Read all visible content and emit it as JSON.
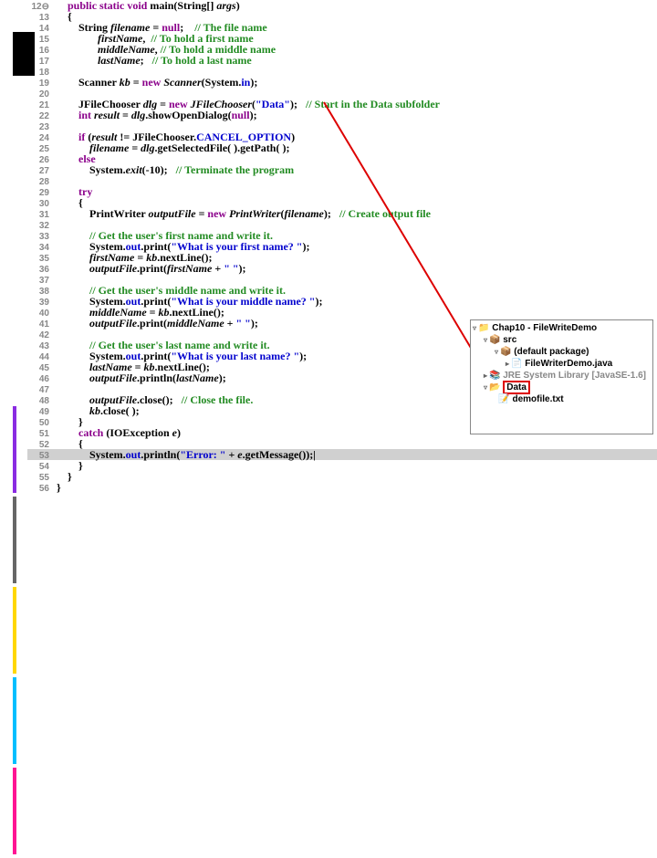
{
  "lines": [
    {
      "n": "12⊖",
      "tokens": [
        [
          "    ",
          "p"
        ],
        [
          "public static void",
          "kw"
        ],
        [
          " ",
          "p"
        ],
        [
          "main",
          "mth"
        ],
        [
          "(String[] ",
          "p"
        ],
        [
          "args",
          "id"
        ],
        [
          ")",
          "p"
        ]
      ]
    },
    {
      "n": "13",
      "tokens": [
        [
          "    {",
          "p"
        ]
      ]
    },
    {
      "n": "14",
      "tokens": [
        [
          "        String ",
          "p"
        ],
        [
          "filename",
          "id"
        ],
        [
          " = ",
          "p"
        ],
        [
          "null",
          "kw"
        ],
        [
          ";    ",
          "p"
        ],
        [
          "// The file name",
          "com"
        ]
      ]
    },
    {
      "n": "15",
      "tokens": [
        [
          "               ",
          "p"
        ],
        [
          "firstName",
          "id"
        ],
        [
          ",  ",
          "p"
        ],
        [
          "// To hold a first name",
          "com"
        ]
      ]
    },
    {
      "n": "16",
      "tokens": [
        [
          "               ",
          "p"
        ],
        [
          "middleName",
          "id"
        ],
        [
          ", ",
          "p"
        ],
        [
          "// To hold a middle name",
          "com"
        ]
      ]
    },
    {
      "n": "17",
      "tokens": [
        [
          "               ",
          "p"
        ],
        [
          "lastName",
          "id"
        ],
        [
          ";   ",
          "p"
        ],
        [
          "// To hold a last name",
          "com"
        ]
      ]
    },
    {
      "n": "18",
      "tokens": []
    },
    {
      "n": "19",
      "tokens": [
        [
          "        Scanner ",
          "p"
        ],
        [
          "kb",
          "id"
        ],
        [
          " = ",
          "p"
        ],
        [
          "new",
          "kw"
        ],
        [
          " ",
          "p"
        ],
        [
          "Scanner",
          "id"
        ],
        [
          "(System.",
          "p"
        ],
        [
          "in",
          "fld"
        ],
        [
          ");",
          "p"
        ]
      ]
    },
    {
      "n": "20",
      "tokens": []
    },
    {
      "n": "21",
      "tokens": [
        [
          "        JFileChooser ",
          "p"
        ],
        [
          "dlg",
          "id"
        ],
        [
          " = ",
          "p"
        ],
        [
          "new",
          "kw"
        ],
        [
          " ",
          "p"
        ],
        [
          "JFileChooser",
          "id"
        ],
        [
          "(",
          "p"
        ],
        [
          "\"Data\"",
          "str"
        ],
        [
          ");   ",
          "p"
        ],
        [
          "// Start in the Data subfolder",
          "com"
        ]
      ]
    },
    {
      "n": "22",
      "tokens": [
        [
          "        ",
          "p"
        ],
        [
          "int",
          "kw"
        ],
        [
          " ",
          "p"
        ],
        [
          "result",
          "id"
        ],
        [
          " = ",
          "p"
        ],
        [
          "dlg",
          "id"
        ],
        [
          ".showOpenDialog(",
          "p"
        ],
        [
          "null",
          "kw"
        ],
        [
          ");",
          "p"
        ]
      ]
    },
    {
      "n": "23",
      "tokens": []
    },
    {
      "n": "24",
      "tokens": [
        [
          "        ",
          "p"
        ],
        [
          "if",
          "kw"
        ],
        [
          " (",
          "p"
        ],
        [
          "result",
          "id"
        ],
        [
          " != JFileChooser.",
          "p"
        ],
        [
          "CANCEL_OPTION",
          "cn"
        ],
        [
          ")",
          "p"
        ]
      ]
    },
    {
      "n": "25",
      "tokens": [
        [
          "            ",
          "p"
        ],
        [
          "filename",
          "id"
        ],
        [
          " = ",
          "p"
        ],
        [
          "dlg",
          "id"
        ],
        [
          ".getSelectedFile( ).getPath( );",
          "p"
        ]
      ]
    },
    {
      "n": "26",
      "tokens": [
        [
          "        ",
          "p"
        ],
        [
          "else",
          "kw"
        ]
      ]
    },
    {
      "n": "27",
      "tokens": [
        [
          "            System.",
          "p"
        ],
        [
          "exit",
          "id"
        ],
        [
          "(-10);   ",
          "p"
        ],
        [
          "// Terminate the program",
          "com"
        ]
      ]
    },
    {
      "n": "28",
      "tokens": []
    },
    {
      "n": "29",
      "tokens": [
        [
          "        ",
          "p"
        ],
        [
          "try",
          "kw"
        ]
      ]
    },
    {
      "n": "30",
      "tokens": [
        [
          "        {",
          "p"
        ]
      ]
    },
    {
      "n": "31",
      "tokens": [
        [
          "            PrintWriter ",
          "p"
        ],
        [
          "outputFile",
          "id"
        ],
        [
          " = ",
          "p"
        ],
        [
          "new",
          "kw"
        ],
        [
          " ",
          "p"
        ],
        [
          "PrintWriter",
          "id"
        ],
        [
          "(",
          "p"
        ],
        [
          "filename",
          "id"
        ],
        [
          ");   ",
          "p"
        ],
        [
          "// Create output file",
          "com"
        ]
      ]
    },
    {
      "n": "32",
      "tokens": []
    },
    {
      "n": "33",
      "tokens": [
        [
          "            ",
          "p"
        ],
        [
          "// Get the user's first name and write it.",
          "com"
        ]
      ]
    },
    {
      "n": "34",
      "tokens": [
        [
          "            System.",
          "p"
        ],
        [
          "out",
          "fld"
        ],
        [
          ".print(",
          "p"
        ],
        [
          "\"What is your first name? \"",
          "str"
        ],
        [
          ");",
          "p"
        ]
      ]
    },
    {
      "n": "35",
      "tokens": [
        [
          "            ",
          "p"
        ],
        [
          "firstName",
          "id"
        ],
        [
          " = ",
          "p"
        ],
        [
          "kb",
          "id"
        ],
        [
          ".nextLine();",
          "p"
        ]
      ]
    },
    {
      "n": "36",
      "tokens": [
        [
          "            ",
          "p"
        ],
        [
          "outputFile",
          "id"
        ],
        [
          ".print(",
          "p"
        ],
        [
          "firstName",
          "id"
        ],
        [
          " + ",
          "p"
        ],
        [
          "\" \"",
          "str"
        ],
        [
          ");",
          "p"
        ]
      ]
    },
    {
      "n": "37",
      "tokens": []
    },
    {
      "n": "38",
      "tokens": [
        [
          "            ",
          "p"
        ],
        [
          "// Get the user's middle name and write it.",
          "com"
        ]
      ]
    },
    {
      "n": "39",
      "tokens": [
        [
          "            System.",
          "p"
        ],
        [
          "out",
          "fld"
        ],
        [
          ".print(",
          "p"
        ],
        [
          "\"What is your middle name? \"",
          "str"
        ],
        [
          ");",
          "p"
        ]
      ]
    },
    {
      "n": "40",
      "tokens": [
        [
          "            ",
          "p"
        ],
        [
          "middleName",
          "id"
        ],
        [
          " = ",
          "p"
        ],
        [
          "kb",
          "id"
        ],
        [
          ".nextLine();",
          "p"
        ]
      ]
    },
    {
      "n": "41",
      "tokens": [
        [
          "            ",
          "p"
        ],
        [
          "outputFile",
          "id"
        ],
        [
          ".print(",
          "p"
        ],
        [
          "middleName",
          "id"
        ],
        [
          " + ",
          "p"
        ],
        [
          "\" \"",
          "str"
        ],
        [
          ");",
          "p"
        ]
      ]
    },
    {
      "n": "42",
      "tokens": []
    },
    {
      "n": "43",
      "tokens": [
        [
          "            ",
          "p"
        ],
        [
          "// Get the user's last name and write it.",
          "com"
        ]
      ]
    },
    {
      "n": "44",
      "tokens": [
        [
          "            System.",
          "p"
        ],
        [
          "out",
          "fld"
        ],
        [
          ".print(",
          "p"
        ],
        [
          "\"What is your last name? \"",
          "str"
        ],
        [
          ");",
          "p"
        ]
      ]
    },
    {
      "n": "45",
      "tokens": [
        [
          "            ",
          "p"
        ],
        [
          "lastName",
          "id"
        ],
        [
          " = ",
          "p"
        ],
        [
          "kb",
          "id"
        ],
        [
          ".nextLine();",
          "p"
        ]
      ]
    },
    {
      "n": "46",
      "tokens": [
        [
          "            ",
          "p"
        ],
        [
          "outputFile",
          "id"
        ],
        [
          ".println(",
          "p"
        ],
        [
          "lastName",
          "id"
        ],
        [
          ");",
          "p"
        ]
      ]
    },
    {
      "n": "47",
      "tokens": []
    },
    {
      "n": "48",
      "tokens": [
        [
          "            ",
          "p"
        ],
        [
          "outputFile",
          "id"
        ],
        [
          ".close();   ",
          "p"
        ],
        [
          "// Close the file.",
          "com"
        ]
      ]
    },
    {
      "n": "49",
      "tokens": [
        [
          "            ",
          "p"
        ],
        [
          "kb",
          "id"
        ],
        [
          ".close( );",
          "p"
        ]
      ]
    },
    {
      "n": "50",
      "tokens": [
        [
          "        }",
          "p"
        ]
      ]
    },
    {
      "n": "51",
      "tokens": [
        [
          "        ",
          "p"
        ],
        [
          "catch",
          "kw"
        ],
        [
          " (IOException ",
          "p"
        ],
        [
          "e",
          "id"
        ],
        [
          ")",
          "p"
        ]
      ]
    },
    {
      "n": "52",
      "tokens": [
        [
          "        {",
          "p"
        ]
      ]
    },
    {
      "n": "53",
      "hl": true,
      "tokens": [
        [
          "            System.",
          "p"
        ],
        [
          "out",
          "fld"
        ],
        [
          ".println(",
          "p"
        ],
        [
          "\"Error: \"",
          "str"
        ],
        [
          " + ",
          "p"
        ],
        [
          "e",
          "id"
        ],
        [
          ".getMessage());",
          "p"
        ],
        [
          "|",
          "p"
        ]
      ]
    },
    {
      "n": "54",
      "tokens": [
        [
          "        }",
          "p"
        ]
      ]
    },
    {
      "n": "55",
      "tokens": [
        [
          "    }",
          "p"
        ]
      ]
    },
    {
      "n": "56",
      "tokens": [
        [
          "}",
          "p"
        ]
      ]
    }
  ],
  "tree": {
    "rows": [
      {
        "indent": 0,
        "exp": "▿",
        "icon": "📁",
        "label": "Chap10 - FileWriteDemo"
      },
      {
        "indent": 1,
        "exp": "▿",
        "icon": "📦",
        "label": "src"
      },
      {
        "indent": 2,
        "exp": "▿",
        "icon": "📦",
        "label": "(default package)"
      },
      {
        "indent": 3,
        "exp": "▸",
        "icon": "📄",
        "label": "FileWriterDemo.java"
      },
      {
        "indent": 1,
        "exp": "▸",
        "icon": "📚",
        "label": "JRE System Library [JavaSE-1.6]",
        "style": "color:#888"
      },
      {
        "indent": 1,
        "exp": "▿",
        "icon": "📂",
        "label": "Data",
        "sel": true
      },
      {
        "indent": 2,
        "exp": "",
        "icon": "📝",
        "label": "demofile.txt"
      }
    ]
  },
  "stripes": [
    "#8a2be2",
    "#666",
    "#ffd700",
    "#00bfff",
    "#ff1493"
  ]
}
